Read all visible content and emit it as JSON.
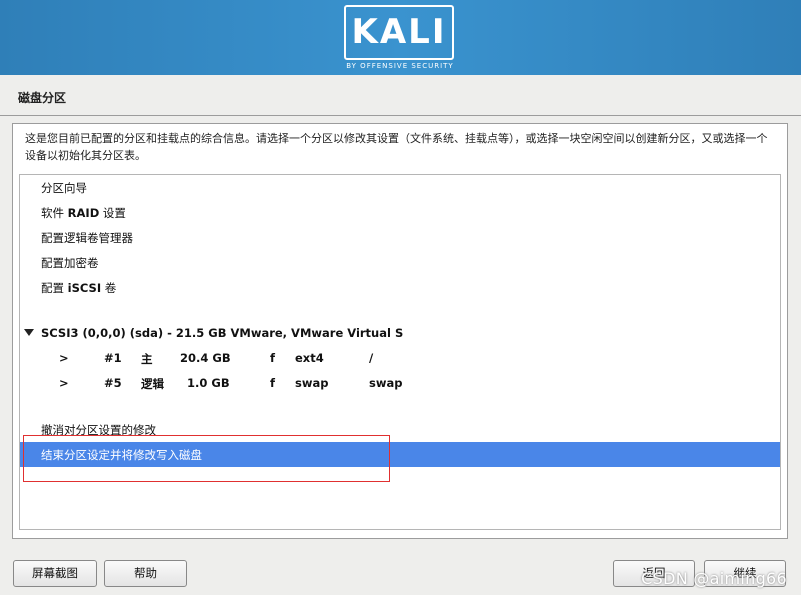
{
  "brand": {
    "logo_text": "KALI",
    "logo_subtitle": "BY OFFENSIVE SECURITY",
    "banner_color": "#3a93cf"
  },
  "page": {
    "title": "磁盘分区",
    "description": "这是您目前已配置的分区和挂载点的综合信息。请选择一个分区以修改其设置（文件系统、挂载点等），或选择一块空闲空间以创建新分区，又或选择一个设备以初始化其分区表。"
  },
  "menu": [
    {
      "label": "分区向导"
    },
    {
      "label_prefix": "软件 ",
      "label_bold": "RAID",
      "label_suffix": " 设置"
    },
    {
      "label": "配置逻辑卷管理器"
    },
    {
      "label": "配置加密卷"
    },
    {
      "label_prefix": "配置 ",
      "label_bold": "iSCSI",
      "label_suffix": " 卷"
    }
  ],
  "disk": {
    "label": "SCSI3 (0,0,0) (sda) - 21.5 GB VMware, VMware Virtual S",
    "partitions": [
      {
        "arrow": ">",
        "number": "#1",
        "type": "主",
        "size": "20.4 GB",
        "flag": "f",
        "fs": "ext4",
        "mount": "/"
      },
      {
        "arrow": ">",
        "number": "#5",
        "type": "逻辑",
        "size": "1.0 GB",
        "flag": "f",
        "fs": "swap",
        "mount": "swap"
      }
    ]
  },
  "actions": [
    {
      "label": "撤消对分区设置的修改"
    },
    {
      "label": "结束分区设定并将修改写入磁盘",
      "selected": true
    }
  ],
  "buttons": {
    "screenshot": "屏幕截图",
    "help": "帮助",
    "back": "返回",
    "continue": "继续"
  },
  "watermark": "CSDN @aiming66",
  "colors": {
    "selection": "#4a86e8",
    "highlight_box": "#e03030"
  }
}
